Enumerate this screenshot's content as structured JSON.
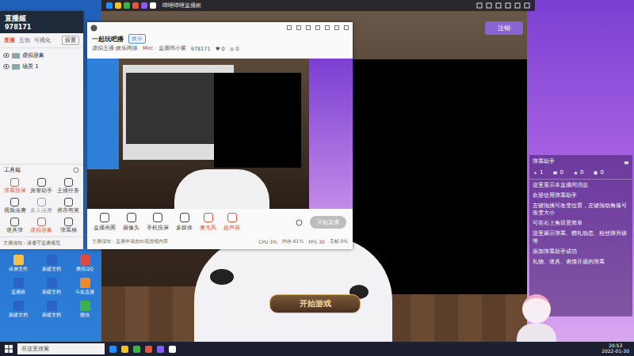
{
  "app_titlebar": {
    "title": "哔哩哔哩直播姬"
  },
  "tool_window": {
    "logo": "直播姬",
    "room_id": "978171",
    "settings_button": "设置",
    "tabs": [
      {
        "label": "直播",
        "selected": true
      },
      {
        "label": "互动",
        "selected": false
      },
      {
        "label": "可视化",
        "selected": false
      }
    ],
    "scenes": [
      {
        "label": "虚拟形象",
        "visible": true
      },
      {
        "label": "场景 1",
        "visible": true
      }
    ],
    "toolbox_title": "工具箱",
    "tools": [
      {
        "label": "弹幕投屏",
        "color": "#e8553b"
      },
      {
        "label": "房管助手",
        "color": "#4a4a4a"
      },
      {
        "label": "主播任务",
        "color": "#4a4a4a"
      },
      {
        "label": "视频连麦",
        "color": "#4a4a4a"
      },
      {
        "label": "多人连麦",
        "color": "#a0a0a0"
      },
      {
        "label": "推荐有奖",
        "color": "#4a4a4a"
      },
      {
        "label": "道具弹",
        "color": "#4a4a4a"
      },
      {
        "label": "虚拟形象",
        "color": "#e8553b"
      },
      {
        "label": "弹幕稿",
        "color": "#4a4a4a"
      }
    ],
    "notice": "主播须知：请遵守直播规范"
  },
  "main_window": {
    "title": "一起玩吧播",
    "tag": "娱乐",
    "category": "虚拟主播·娱乐闲谈",
    "room_name": "Mirc · 直播间小窗",
    "room_id": "978171",
    "likes": "0",
    "viewers": "0",
    "toolbar": [
      {
        "label": "直播画面",
        "color": "#444444"
      },
      {
        "label": "摄像头",
        "color": "#444444"
      },
      {
        "label": "手机投屏",
        "color": "#444444"
      },
      {
        "label": "多媒体",
        "color": "#444444"
      },
      {
        "label": "麦克风",
        "color": "#e8553b"
      },
      {
        "label": "扬声器",
        "color": "#e8553b"
      }
    ],
    "start_button": "开始直播",
    "hint": "主播须知：直播中请勿出现违规内容",
    "status": [
      "CPU 3%",
      "内存 61%",
      "FPS 30",
      "丢帧 0%"
    ]
  },
  "game": {
    "start_button": "开始游戏",
    "logout_button": "注销"
  },
  "chat": {
    "title": "弹幕助手",
    "stats": [
      "1",
      "0",
      "0",
      "0"
    ],
    "messages": [
      "这里显示本直播间消息",
      "欢迎使用弹幕助手",
      "左键拖拽可改变位置，左键拖动角落可改变大小",
      "可在右上角设置简单",
      "这里展示弹幕、赠礼动态、粉丝牌升级等",
      "添加弹幕助手成功",
      "礼物、道具、表情开通的弹幕"
    ]
  },
  "desktop_icons": [
    {
      "label": "录屏文件",
      "color": "#f2c14e"
    },
    {
      "label": "新建文档",
      "color": "#2b63c5"
    },
    {
      "label": "腾讯QQ",
      "color": "#e04a3f"
    },
    {
      "label": "直播姬",
      "color": "#2b63c5"
    },
    {
      "label": "新建文档",
      "color": "#2b63c5"
    },
    {
      "label": "斗鱼直播",
      "color": "#f08a24"
    },
    {
      "label": "新建文档",
      "color": "#2b63c5"
    },
    {
      "label": "新建文档",
      "color": "#2b63c5"
    },
    {
      "label": "微信",
      "color": "#3cb34a"
    }
  ],
  "taskbar": {
    "search_placeholder": "在这里搜索",
    "time": "20:53",
    "date": "2022-01-30"
  }
}
